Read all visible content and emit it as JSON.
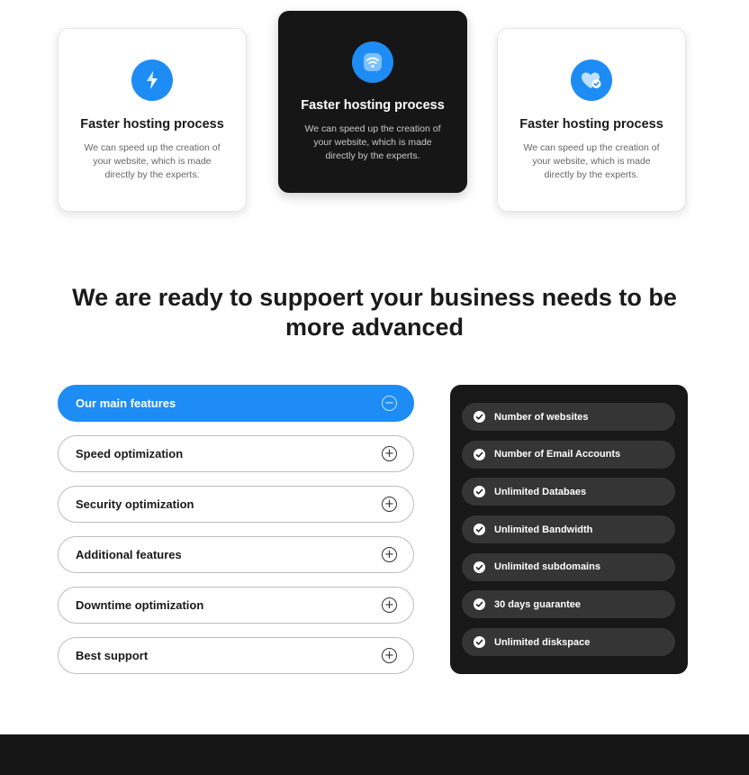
{
  "cards": [
    {
      "title": "Faster hosting process",
      "description": "We can speed up the creation of your website, which is made directly by the experts.",
      "icon": "lightning-icon",
      "theme": "light"
    },
    {
      "title": "Faster hosting process",
      "description": "We can speed up the creation of your website, which is made directly by the experts.",
      "icon": "wifi-icon",
      "theme": "dark"
    },
    {
      "title": "Faster hosting process",
      "description": "We can speed up the creation of your website, which is made directly by the experts.",
      "icon": "heart-check-icon",
      "theme": "light"
    }
  ],
  "heading": "We are ready to suppoert your business needs to be more advanced",
  "accordion": [
    {
      "label": "Our main features",
      "active": true,
      "toggle": "−"
    },
    {
      "label": "Speed optimization",
      "active": false,
      "toggle": "+"
    },
    {
      "label": "Security optimization",
      "active": false,
      "toggle": "+"
    },
    {
      "label": "Additional features",
      "active": false,
      "toggle": "+"
    },
    {
      "label": "Downtime optimization",
      "active": false,
      "toggle": "+"
    },
    {
      "label": "Best support",
      "active": false,
      "toggle": "+"
    }
  ],
  "features": [
    "Number of websites",
    "Number of Email Accounts",
    "Unlimited Databaes",
    "Unlimited Bandwidth",
    "Unlimited subdomains",
    "30 days guarantee",
    "Unlimited diskspace"
  ],
  "colors": {
    "accent": "#1e8cf5",
    "dark": "#181818",
    "pill": "#353535"
  }
}
